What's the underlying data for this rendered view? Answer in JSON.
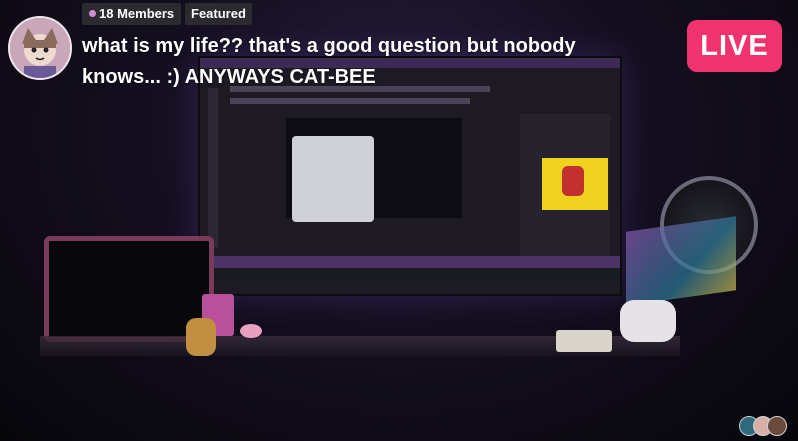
{
  "header": {
    "members_badge": "18 Members",
    "featured_badge": "Featured",
    "title": "what is my life?? that's a good question but nobody knows... :) ANYWAYS CAT-BEE",
    "live_badge": "LIVE"
  },
  "colors": {
    "live_accent": "#f0336e",
    "badge_bg": "#2b2a2f",
    "member_dot": "#d48bd6"
  },
  "icons": {
    "host_avatar": "avatar",
    "viewer_avatars": [
      "viewer-avatar",
      "viewer-avatar",
      "viewer-avatar"
    ]
  }
}
